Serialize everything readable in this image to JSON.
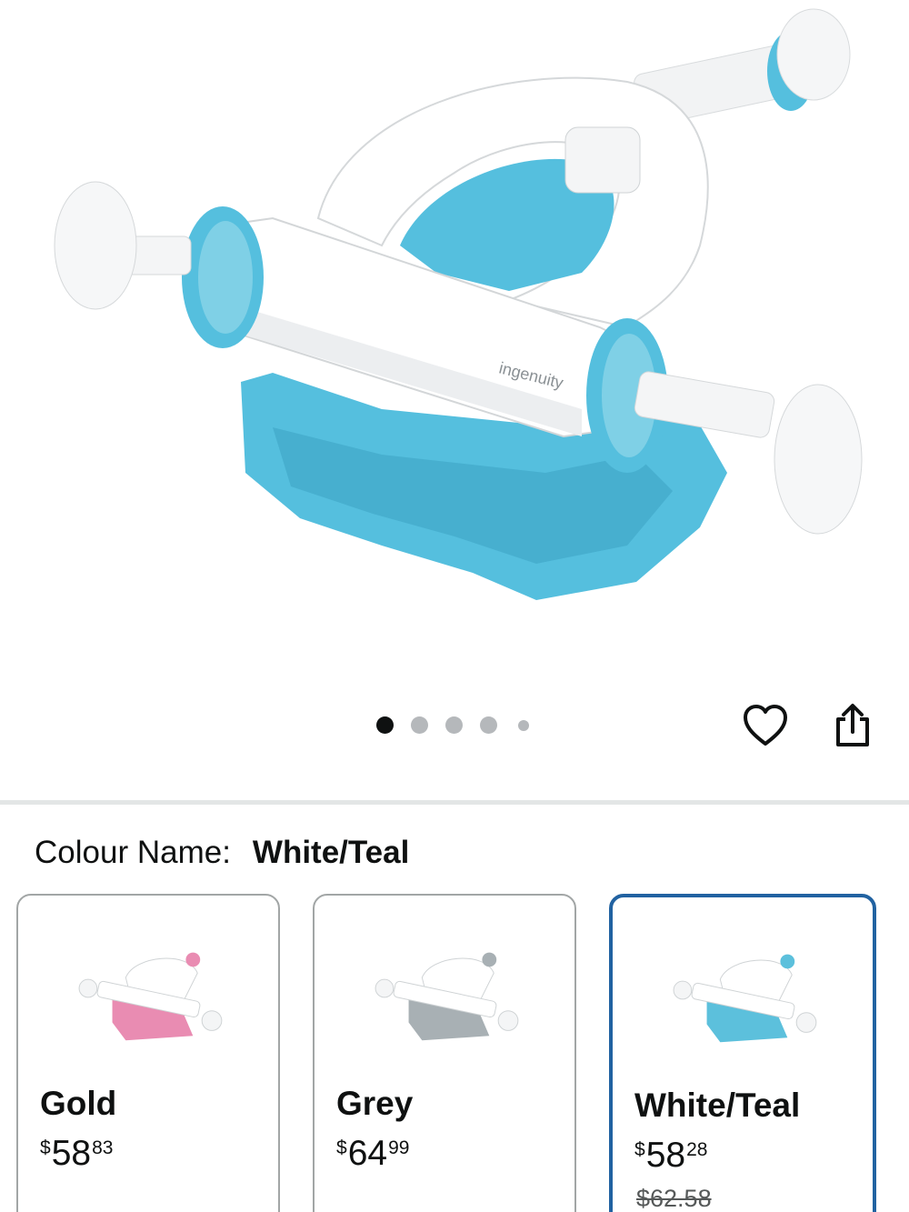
{
  "product": {
    "brand_mark": "ingenuity",
    "gallery": {
      "count": 5,
      "active_index": 0
    }
  },
  "actions": {
    "favourite_icon": "heart-icon",
    "share_icon": "share-icon"
  },
  "colour": {
    "label": "Colour Name:",
    "selected": "White/Teal",
    "options": [
      {
        "name": "Gold",
        "price_currency": "$",
        "price_whole": "58",
        "price_fraction": "83",
        "base_color": "#e98cb2",
        "selected": false
      },
      {
        "name": "Grey",
        "price_currency": "$",
        "price_whole": "64",
        "price_fraction": "99",
        "base_color": "#a8b0b4",
        "selected": false
      },
      {
        "name": "White/Teal",
        "price_currency": "$",
        "price_whole": "58",
        "price_fraction": "28",
        "old_price": "$62.58",
        "base_color": "#5cc0dc",
        "selected": true
      }
    ]
  },
  "colors": {
    "teal": "#55bfde",
    "selected_border": "#2162a1",
    "card_border": "#a2a6a6"
  }
}
